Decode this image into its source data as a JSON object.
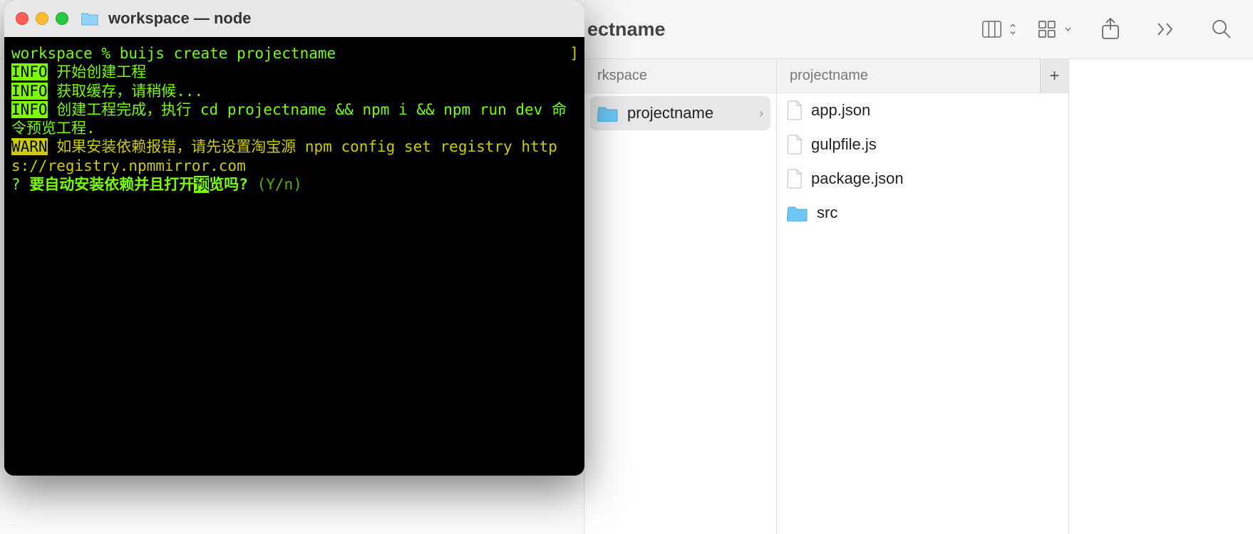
{
  "terminal": {
    "window_title": "workspace — node",
    "prompt": "workspace % ",
    "command": "buijs create projectname",
    "lines": {
      "info_label": "INFO",
      "warn_label": "WARN",
      "info1": "开始创建工程",
      "info2": "获取缓存，请稍候...",
      "info3_a": "创建工程完成，执行 ",
      "info3_cmd": "cd projectname && npm i && npm run dev",
      "info3_b": " 命令预览工程.",
      "warn_a": "如果安装依赖报错，请先设置淘宝源 ",
      "warn_cmd": "npm config set registry https://registry.npmmirror.com",
      "prompt_q_mark": "?",
      "prompt_q_pre": "要自动安装依赖并且打开",
      "prompt_q_cursor": "预",
      "prompt_q_post": "览吗?",
      "prompt_hint": "(Y/n)",
      "bracket": "]"
    }
  },
  "finder": {
    "title_partial": "ectname",
    "col1_header": "rkspace",
    "col2_header": "projectname",
    "col1_items": [
      {
        "name": "projectname",
        "type": "folder",
        "selected": true
      }
    ],
    "col2_items": [
      {
        "name": "app.json",
        "type": "file"
      },
      {
        "name": "gulpfile.js",
        "type": "file"
      },
      {
        "name": "package.json",
        "type": "file"
      },
      {
        "name": "src",
        "type": "folder"
      }
    ],
    "icons": {
      "view": "columns",
      "group": "grid-chevron",
      "share": "share",
      "more": "chevrons",
      "search": "search",
      "add": "+"
    }
  }
}
